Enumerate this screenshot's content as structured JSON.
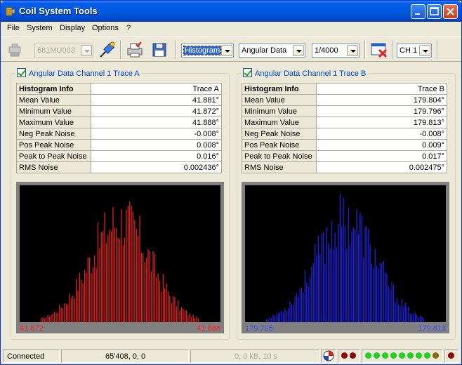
{
  "window": {
    "title": "Coil System Tools"
  },
  "menu": [
    "File",
    "System",
    "Display",
    "Options",
    "?"
  ],
  "toolbar": {
    "device_combo": "681MU003",
    "mode_combo": "Histogram",
    "data_combo": "Angular Data",
    "rate_combo": "1/4000",
    "channel_combo": "CH 1"
  },
  "panels": [
    {
      "title": "Angular Data Channel 1 Trace A",
      "header": [
        "Histogram Info",
        "Trace A"
      ],
      "rows": [
        [
          "Mean Value",
          "41.881°"
        ],
        [
          "Minimum Value",
          "41.872°"
        ],
        [
          "Maximum Value",
          "41.888°"
        ],
        [
          "Neg Peak Noise",
          "-0.008°"
        ],
        [
          "Pos Peak Noise",
          "0.008°"
        ],
        [
          "Peak to Peak Noise",
          "0.016°"
        ],
        [
          "RMS Noise",
          "0.002436°"
        ]
      ],
      "xmin_label": "41.872",
      "xmax_label": "41.888",
      "color": "#E02020",
      "label_color": "#FF2020"
    },
    {
      "title": "Angular Data Channel 1 Trace B",
      "header": [
        "Histogram Info",
        "Trace B"
      ],
      "rows": [
        [
          "Mean Value",
          "179.804°"
        ],
        [
          "Minimum Value",
          "179.796°"
        ],
        [
          "Maximum Value",
          "179.813°"
        ],
        [
          "Neg Peak Noise",
          "-0.008°"
        ],
        [
          "Pos Peak Noise",
          "0.009°"
        ],
        [
          "Peak to Peak Noise",
          "0.017°"
        ],
        [
          "RMS Noise",
          "0.002475°"
        ]
      ],
      "xmin_label": "179.796",
      "xmax_label": "179.813",
      "color": "#2020E0",
      "label_color": "#3050FF"
    }
  ],
  "status": {
    "connection": "Connected",
    "position": "65'408, 0, 0",
    "transfer": "0, 0 kB, 10 s"
  },
  "icons": [
    "coil-app-icon",
    "connect-plug-icon",
    "probe-icon",
    "print-icon",
    "save-icon",
    "clear-icon",
    "pointer-icon"
  ]
}
